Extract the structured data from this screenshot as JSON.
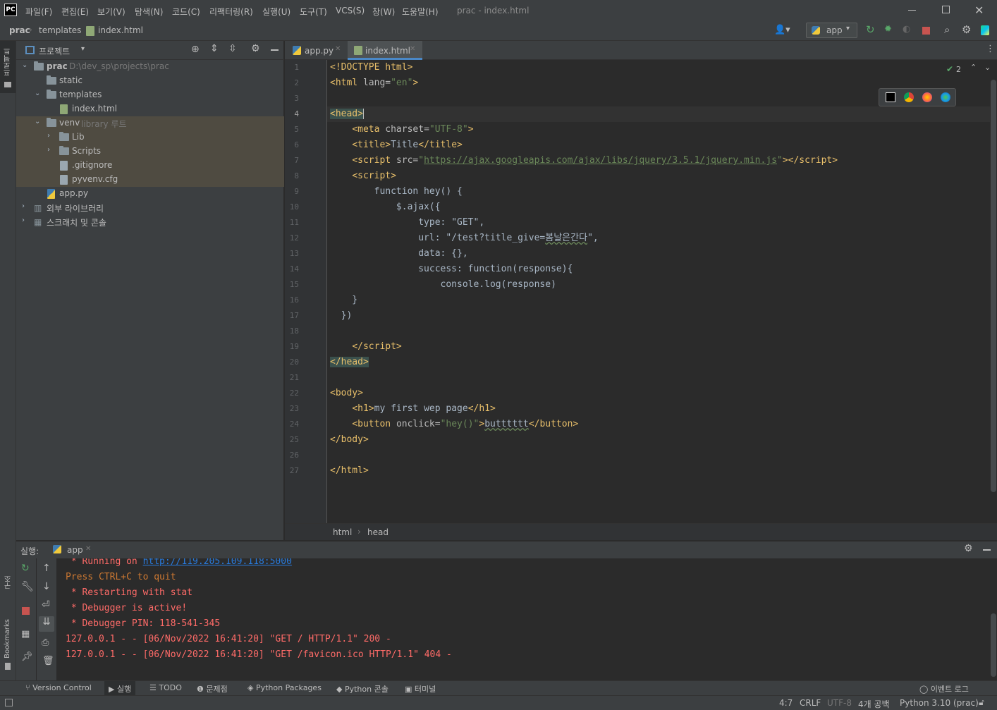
{
  "app": {
    "logo": "PC",
    "window_title": "prac - index.html"
  },
  "menu": [
    "파일(F)",
    "편집(E)",
    "보기(V)",
    "탐색(N)",
    "코드(C)",
    "리팩터링(R)",
    "실행(U)",
    "도구(T)",
    "VCS(S)",
    "창(W)",
    "도움말(H)"
  ],
  "breadcrumb": {
    "project": "prac",
    "folder": "templates",
    "file": "index.html"
  },
  "toolbar": {
    "run_config": "app"
  },
  "left_strip": {
    "project_tab": "프로젝트",
    "structure_tab": "구조",
    "bookmarks_tab": "Bookmarks"
  },
  "project_panel": {
    "title": "프로젝트",
    "tree": [
      {
        "label": "prac",
        "hint": "D:\\dev_sp\\projects\\prac"
      },
      {
        "label": "static"
      },
      {
        "label": "templates"
      },
      {
        "label": "index.html"
      },
      {
        "label": "venv",
        "hint": "library 루트"
      },
      {
        "label": "Lib"
      },
      {
        "label": "Scripts"
      },
      {
        "label": ".gitignore"
      },
      {
        "label": "pyvenv.cfg"
      },
      {
        "label": "app.py"
      },
      {
        "label": "외부 라이브러리"
      },
      {
        "label": "스크래치 및 콘솔"
      }
    ]
  },
  "editor": {
    "tabs": [
      {
        "label": "app.py",
        "active": false
      },
      {
        "label": "index.html",
        "active": true
      }
    ],
    "inspections": "2",
    "line_numbers": [
      "1",
      "2",
      "3",
      "4",
      "5",
      "6",
      "7",
      "8",
      "9",
      "10",
      "11",
      "12",
      "13",
      "14",
      "15",
      "16",
      "17",
      "18",
      "19",
      "20",
      "21",
      "22",
      "23",
      "24",
      "25",
      "26",
      "27"
    ],
    "breadcrumb": [
      "html",
      "head"
    ]
  },
  "run_panel": {
    "label": "실행:",
    "tab": "app",
    "lines": [
      " * Running on http://119.205.109.118:5000",
      "Press CTRL+C to quit",
      " * Restarting with stat",
      " * Debugger is active!",
      " * Debugger PIN: 118-541-345",
      "127.0.0.1 - - [06/Nov/2022 16:41:20] \"GET / HTTP/1.1\" 200 -",
      "127.0.0.1 - - [06/Nov/2022 16:41:20] \"GET /favicon.ico HTTP/1.1\" 404 -"
    ],
    "running_url": "http://119.205.109.118:5000"
  },
  "tool_windows": [
    "Version Control",
    "실행",
    "TODO",
    "문제점",
    "Python Packages",
    "Python 콘솔",
    "터미널",
    "이벤트 로그"
  ],
  "status": {
    "position": "4:7",
    "line_sep": "CRLF",
    "encoding": "UTF-8",
    "indent": "4개 공백",
    "interpreter": "Python 3.10 (prac)"
  },
  "colors": {
    "accent": "#4a88c7",
    "bg_dark": "#2b2b2b",
    "bg_panel": "#3c3f41",
    "tag": "#e8bf6a",
    "string": "#6a8759",
    "error": "#ff6b68"
  }
}
